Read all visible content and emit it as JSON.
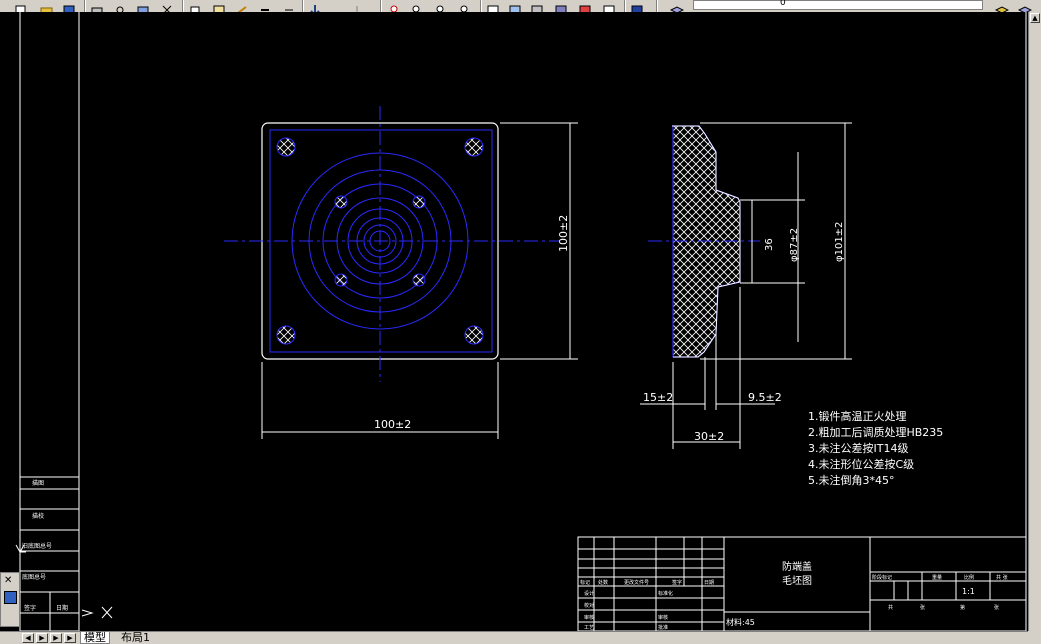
{
  "toolbar": {
    "icons": [
      "new-icon",
      "open-icon",
      "save-icon",
      "print-icon",
      "preview-icon",
      "publish-icon",
      "cut-icon",
      "copy-icon",
      "paste-icon",
      "matchprop-icon",
      "undo-icon",
      "redo-icon",
      "pan-icon",
      "zoom-realtime-icon",
      "zoom-window-icon",
      "zoom-previous-icon",
      "properties-icon",
      "designcenter-icon",
      "toolpalette-icon",
      "sheetset-icon",
      "markup-icon",
      "calculator-icon",
      "help-icon",
      "layer-icon",
      "layer-state-icon"
    ],
    "layer_value": "0"
  },
  "tabs": {
    "model": "模型",
    "layout": "布局1"
  },
  "drawing": {
    "dims": {
      "front_width": "100±2",
      "front_height": "100±2",
      "side_d1": "36",
      "side_d2": "φ87±2",
      "side_d3": "φ101±2",
      "side_15": "15±2",
      "side_95": "9.5±2",
      "side_30": "30±2"
    },
    "notes": [
      "1.锻件高温正火处理",
      "2.粗加工后调质处理HB235",
      "3.未注公差按IT14级",
      "4.未注形位公差按C级",
      "5.未注倒角3*45°"
    ],
    "title_block": {
      "part_name": "防端盖",
      "drawing_type": "毛坯图",
      "scale": "1:1",
      "weight_label": "材料:45",
      "left_rows": [
        "标记",
        "处数",
        "更改文件号",
        "签字",
        "日期"
      ],
      "designer_row": [
        "设计",
        "标准化"
      ],
      "rows2": [
        "校对",
        "审核"
      ],
      "rows3": [
        "审核",
        "批准"
      ],
      "rows4": [
        "工艺",
        "日期"
      ],
      "right_header": [
        "阶段标记",
        "重量",
        "比例",
        "共 张"
      ],
      "right_sub": [
        "共",
        "张",
        "第",
        "张"
      ]
    },
    "left_strip": [
      "描图",
      "描校",
      "旧底图总号",
      "底图总号",
      "签字",
      "日期"
    ]
  },
  "palette": {
    "icons": [
      "close-icon",
      "properties-icon"
    ]
  }
}
